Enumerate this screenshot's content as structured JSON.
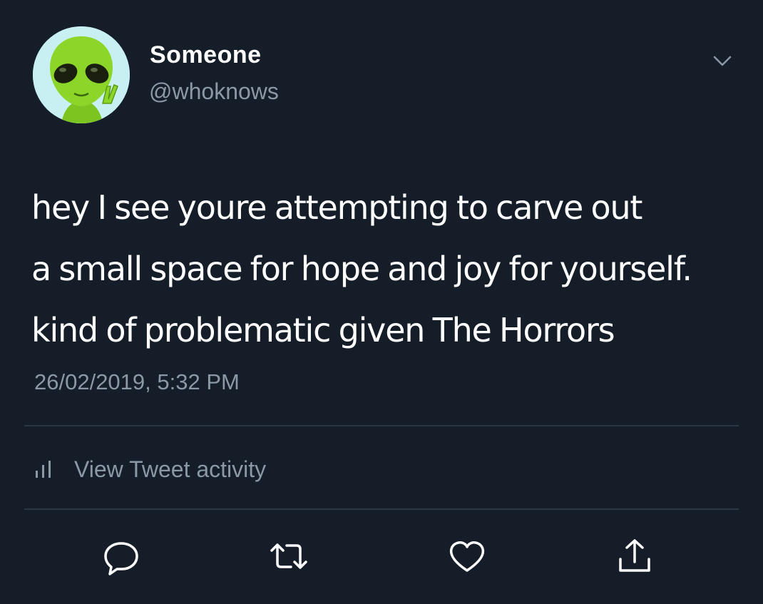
{
  "tweet": {
    "author": {
      "display_name": "Someone",
      "handle": "@whoknows",
      "avatar_icon": "alien-icon"
    },
    "text_lines": [
      "hey I see youre attempting to carve out",
      "a small space for hope and joy for yourself.",
      "kind of problematic given The Horrors"
    ],
    "timestamp": "26/02/2019, 5:32 PM",
    "activity_label": "View Tweet activity",
    "actions": [
      "reply-icon",
      "retweet-icon",
      "like-icon",
      "share-icon"
    ]
  },
  "colors": {
    "background": "#151d28",
    "primary_text": "#ffffff",
    "secondary_text": "#8b98a5",
    "divider": "#2a3644",
    "avatar_bg": "#c8f0f2",
    "alien_green": "#8bd629"
  }
}
